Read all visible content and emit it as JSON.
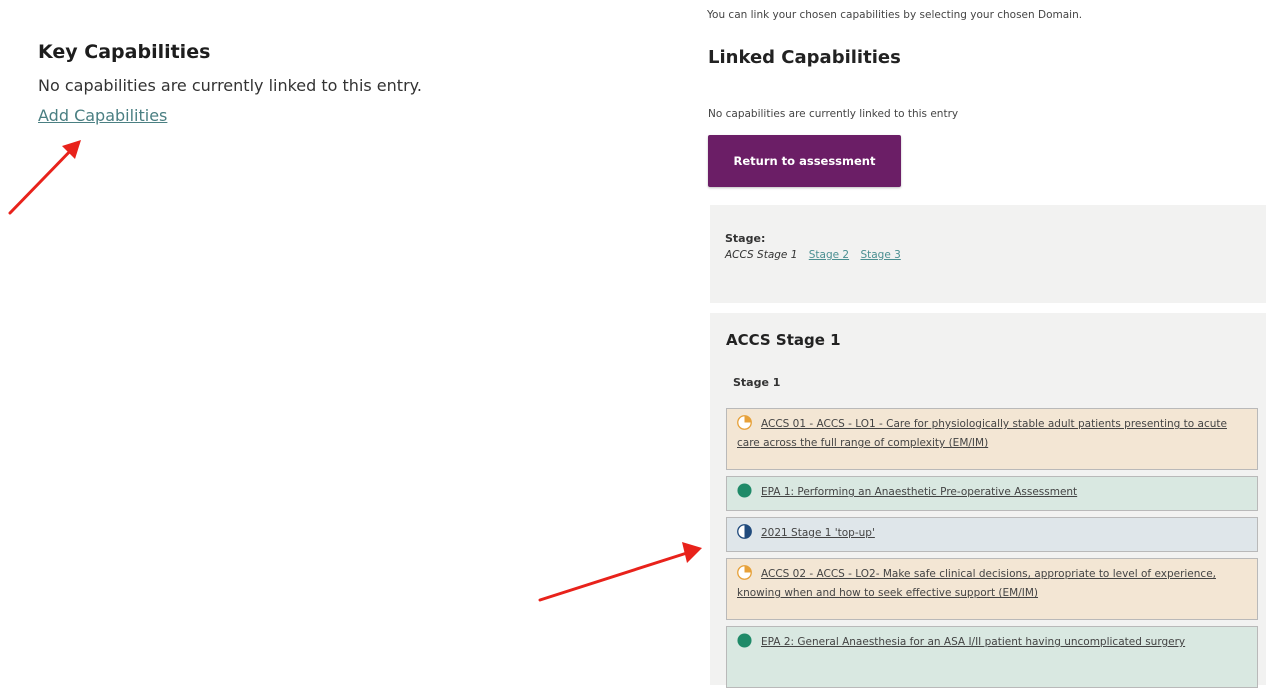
{
  "left": {
    "heading": "Key Capabilities",
    "empty_text": "No capabilities are currently linked to this entry.",
    "add_link": "Add Capabilities"
  },
  "right": {
    "intro": "You can link your chosen capabilities by selecting your chosen Domain.",
    "linked_heading": "Linked Capabilities",
    "linked_empty": "No capabilities are currently linked to this entry",
    "return_button": "Return to assessment",
    "stage_label": "Stage:",
    "stage_current": "ACCS Stage 1",
    "stage_links": [
      "Stage 2",
      "Stage 3"
    ],
    "section_title": "ACCS Stage 1",
    "section_subtitle": "Stage 1",
    "items": [
      {
        "text": "ACCS 01 - ACCS - LO1 - Care for physiologically stable adult patients presenting to acute care across the full range of complexity (EM/IM)",
        "status": "orange-partial-icon"
      },
      {
        "text": "EPA 1: Performing an Anaesthetic Pre-operative Assessment",
        "status": "green-complete-icon"
      },
      {
        "text": "2021 Stage 1 'top-up'",
        "status": "blue-partial-icon"
      },
      {
        "text": "ACCS 02 - ACCS - LO2- Make safe clinical decisions, appropriate to level of experience, knowing when and how to seek effective support (EM/IM)",
        "status": "orange-partial-icon"
      },
      {
        "text": "EPA 2: General Anaesthesia for an ASA I/II patient having uncomplicated surgery",
        "status": "green-complete-icon"
      }
    ]
  },
  "colors": {
    "accent_purple": "#6b1e66",
    "link_teal": "#4a7f82",
    "orange_bg": "#f3e6d4",
    "green_bg": "#d9e8e1",
    "blue_bg": "#dfe6ea",
    "arrow_red": "#e8221b"
  }
}
